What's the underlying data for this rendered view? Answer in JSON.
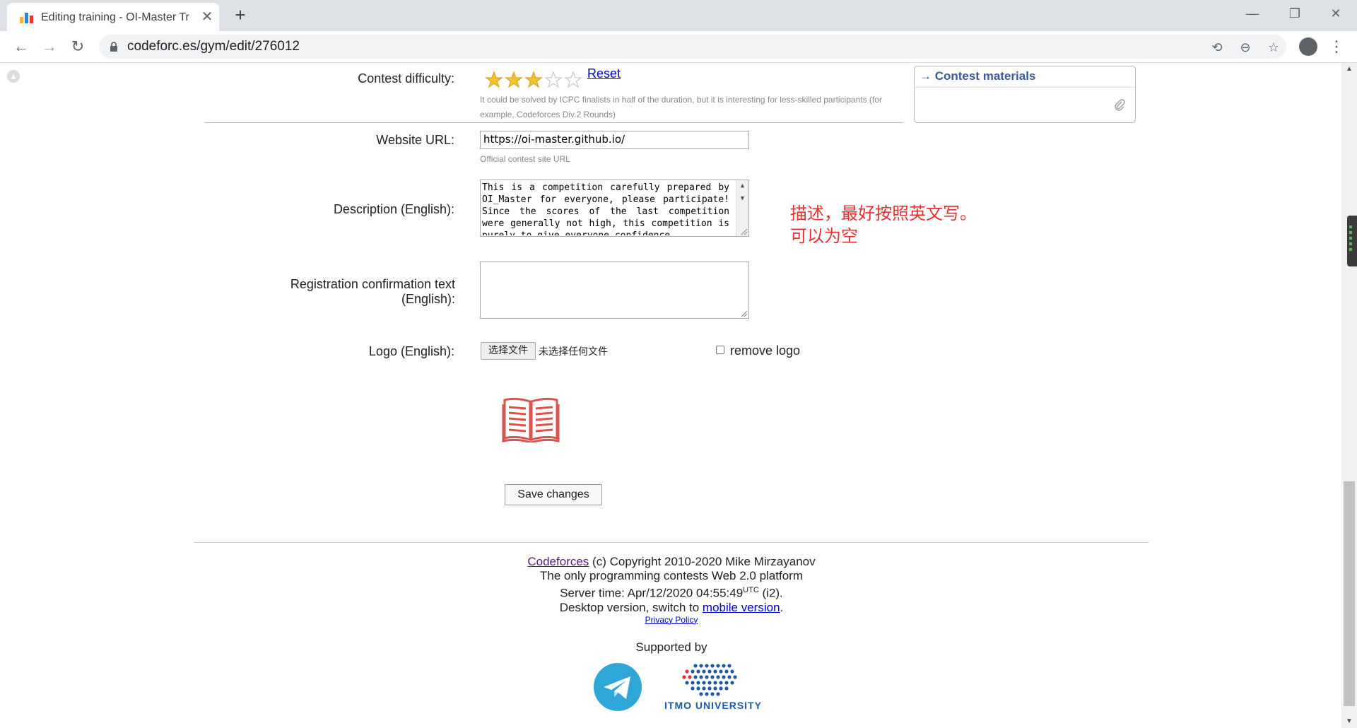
{
  "browser": {
    "tab_title": "Editing training - OI-Master Tr",
    "tab_close": "✕",
    "new_tab": "+",
    "url": "codeforc.es/gym/edit/276012",
    "window": {
      "minimize": "—",
      "restore": "❐",
      "close": "✕"
    },
    "nav": {
      "back": "←",
      "forward": "→",
      "reload": "↻"
    },
    "omni": {
      "translate": "⟲",
      "zoom": "⊖",
      "star": "☆"
    },
    "menu": "⋮"
  },
  "form": {
    "difficulty": {
      "label": "Contest difficulty:",
      "rating": 3,
      "max": 5,
      "reset": "Reset",
      "hint": "It could be solved by ICPC finalists in half of the duration, but it is interesting for less-skilled participants (for example, Codeforces Div.2 Rounds)"
    },
    "website": {
      "label": "Website URL:",
      "value": "https://oi-master.github.io/",
      "hint": "Official contest site URL"
    },
    "description": {
      "label": "Description (English):",
      "value": "This is a competition carefully prepared by OI_Master for everyone, please participate! Since the scores of the last competition were generally not high, this competition is purely to give everyone confidence"
    },
    "registration": {
      "label_line1": "Registration confirmation text",
      "label_line2": "(English):",
      "value": ""
    },
    "logo": {
      "label": "Logo (English):",
      "choose_button": "选择文件",
      "no_file": "未选择任何文件",
      "remove_label": "remove logo"
    },
    "save_button": "Save changes"
  },
  "annotation": {
    "line1": "描述，最好按照英文写。",
    "line2": "可以为空"
  },
  "sidebar": {
    "materials_title": "→ Contest materials"
  },
  "footer": {
    "codeforces_link": "Codeforces",
    "copyright": " (c) Copyright 2010-2020 Mike Mirzayanov",
    "tagline": "The only programming contests Web 2.0 platform",
    "server_time_prefix": "Server time: Apr/12/2020 04:55:49",
    "server_time_tz": "UTC",
    "server_time_suffix": " (i2).",
    "desktop_prefix": "Desktop version, switch to ",
    "mobile_link": "mobile version",
    "desktop_suffix": ".",
    "privacy": "Privacy Policy",
    "supported_by": "Supported by",
    "itmo": "ITMO UNIVERSITY"
  },
  "colors": {
    "annotation": "#e8312f",
    "link": "#0000cc",
    "materials_title": "#3b5998",
    "star": "#f2c230",
    "telegram": "#2ea6d8",
    "itmo_blue": "#1e5aa8"
  }
}
